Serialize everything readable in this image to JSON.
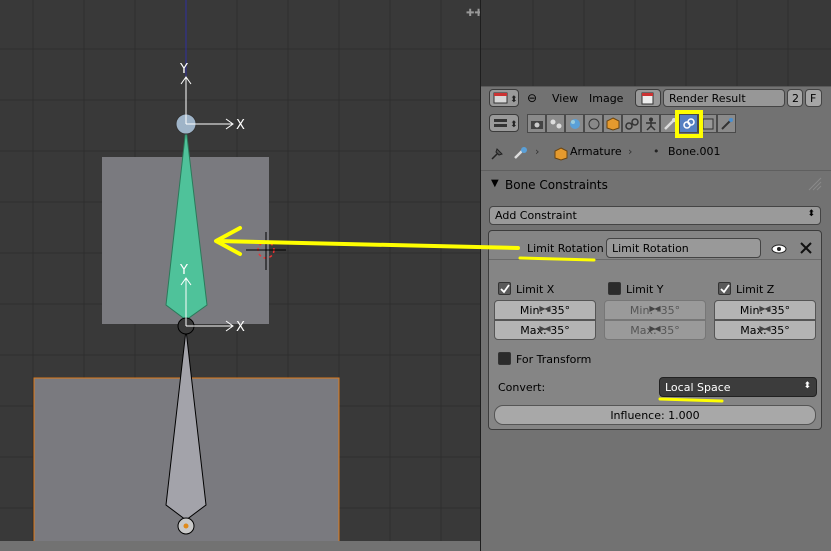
{
  "viewport": {
    "axis_labels": {
      "y_top": "Y",
      "x_top": "X",
      "y_mid": "Y",
      "x_mid": "X"
    }
  },
  "image_editor": {
    "menu": {
      "view": "View",
      "image": "Image"
    },
    "image_name": "Render Result",
    "users": "2",
    "fake_user": "F"
  },
  "properties": {
    "breadcrumb": {
      "object": "Armature",
      "bone": "Bone.001"
    },
    "panel_title": "Bone Constraints",
    "add_constraint": "Add Constraint",
    "constraint": {
      "type_label": "Limit Rotation",
      "name_value": "Limit Rotation",
      "limit_x": {
        "label": "Limit X",
        "checked": true,
        "min": "Min: -35°",
        "max": "Max: 35°"
      },
      "limit_y": {
        "label": "Limit Y",
        "checked": false,
        "min": "Min: -35°",
        "max": "Max: 35°"
      },
      "limit_z": {
        "label": "Limit Z",
        "checked": true,
        "min": "Min: -35°",
        "max": "Max: 35°"
      },
      "for_transform": "For Transform",
      "convert_label": "Convert:",
      "convert_value": "Local Space",
      "influence": "Influence: 1.000"
    }
  },
  "colors": {
    "annotation": "#ffff00",
    "selected_bone": "#4fc29a",
    "active_tab": "#5680c2"
  }
}
